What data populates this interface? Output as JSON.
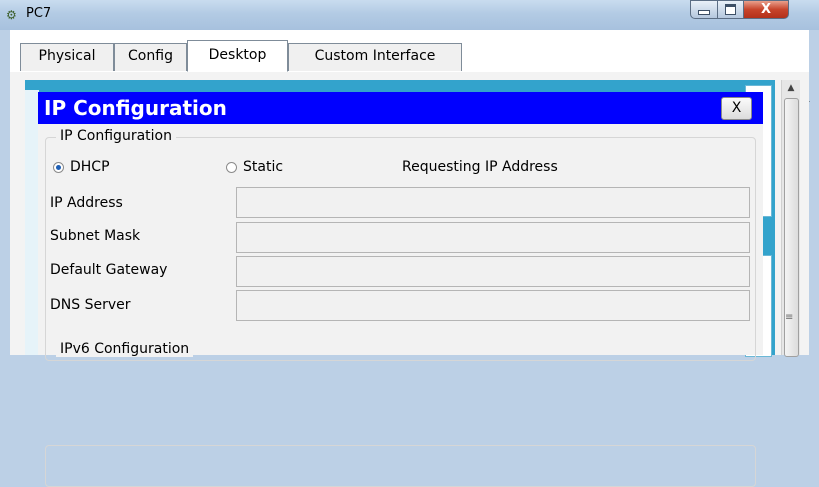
{
  "window": {
    "title": "PC7",
    "close_glyph": "X",
    "icons": {
      "app": "pc-icon",
      "minimize": "minimize-icon",
      "maximize": "maximize-icon",
      "close": "close-icon"
    }
  },
  "tabs": [
    {
      "label": "Physical",
      "active": false
    },
    {
      "label": "Config",
      "active": false
    },
    {
      "label": "Desktop",
      "active": true
    },
    {
      "label": "Custom Interface",
      "active": false
    }
  ],
  "dialog": {
    "title": "IP Configuration",
    "close_label": "X",
    "group_ip": {
      "legend": "IP Configuration",
      "mode": {
        "options": [
          "DHCP",
          "Static"
        ],
        "selected": "DHCP"
      },
      "status": "Requesting IP Address",
      "fields": [
        {
          "label": "IP Address",
          "value": ""
        },
        {
          "label": "Subnet Mask",
          "value": ""
        },
        {
          "label": "Default Gateway",
          "value": ""
        },
        {
          "label": "DNS Server",
          "value": ""
        }
      ]
    },
    "group_ipv6": {
      "legend": "IPv6 Configuration"
    }
  },
  "colors": {
    "dialog_header": "#0000ff",
    "desktop_background": "#33a3cc",
    "radio_selected": "#1e5fb5"
  }
}
